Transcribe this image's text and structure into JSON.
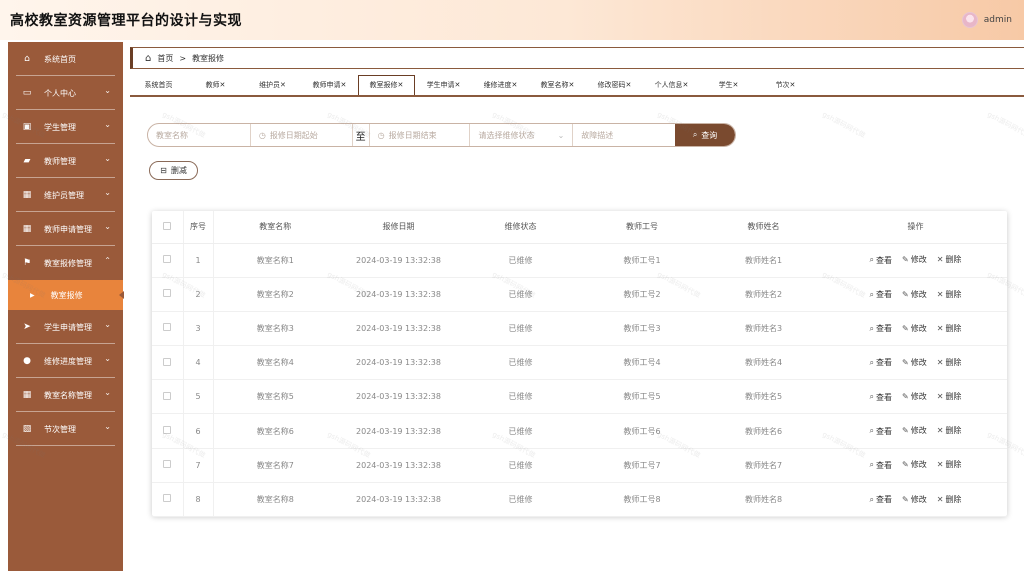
{
  "header": {
    "title": "高校教室资源管理平台的设计与实现",
    "username": "admin"
  },
  "sidebar": {
    "items": [
      {
        "label": "系统首页",
        "icon": "home-icon",
        "glyph": "⌂"
      },
      {
        "label": "个人中心",
        "icon": "id-card-icon",
        "glyph": "▭"
      },
      {
        "label": "学生管理",
        "icon": "clipboard-icon",
        "glyph": "▣"
      },
      {
        "label": "教师管理",
        "icon": "briefcase-icon",
        "glyph": "▰"
      },
      {
        "label": "维护员管理",
        "icon": "grid-icon",
        "glyph": "▦"
      },
      {
        "label": "教师申请管理",
        "icon": "grid-icon",
        "glyph": "▦"
      },
      {
        "label": "教室报修管理",
        "icon": "flag-icon",
        "glyph": "⚑"
      },
      {
        "label": "学生申请管理",
        "icon": "send-icon",
        "glyph": "➤"
      },
      {
        "label": "维修进度管理",
        "icon": "location-pin-icon",
        "glyph": "●"
      },
      {
        "label": "教室名称管理",
        "icon": "grid-icon",
        "glyph": "▦"
      },
      {
        "label": "节次管理",
        "icon": "chart-icon",
        "glyph": "▧"
      }
    ],
    "active_sub": {
      "label": "教室报修",
      "icon": "caret-right-icon",
      "glyph": "▶"
    }
  },
  "breadcrumb": {
    "home": "首页",
    "separator": ">",
    "current": "教室报修"
  },
  "tabs": [
    {
      "label": "系统首页"
    },
    {
      "label": "教师✕"
    },
    {
      "label": "维护员✕"
    },
    {
      "label": "教师申请✕"
    },
    {
      "label": "教室报修✕"
    },
    {
      "label": "学生申请✕"
    },
    {
      "label": "维修进度✕"
    },
    {
      "label": "教室名称✕"
    },
    {
      "label": "修改密码✕"
    },
    {
      "label": "个人信息✕"
    },
    {
      "label": "学生✕"
    },
    {
      "label": "节次✕"
    }
  ],
  "search": {
    "room_placeholder": "教室名称",
    "date_start_placeholder": "报修日期起始",
    "to_label": "至",
    "date_end_placeholder": "报修日期结束",
    "status_placeholder": "请选择维修状态",
    "fault_placeholder": "故障描述",
    "query_label": "查询"
  },
  "toolbar": {
    "delete_label": "删减"
  },
  "table": {
    "headers": [
      "序号",
      "教室名称",
      "报修日期",
      "维修状态",
      "教师工号",
      "教师姓名",
      "操作"
    ],
    "actions": {
      "view": "查看",
      "edit": "修改",
      "delete": "删除"
    },
    "rows": [
      {
        "no": "1",
        "room": "教室名称1",
        "date": "2024-03-19 13:32:38",
        "status": "已维修",
        "teacher_id": "教师工号1",
        "teacher_name": "教师姓名1"
      },
      {
        "no": "2",
        "room": "教室名称2",
        "date": "2024-03-19 13:32:38",
        "status": "已维修",
        "teacher_id": "教师工号2",
        "teacher_name": "教师姓名2"
      },
      {
        "no": "3",
        "room": "教室名称3",
        "date": "2024-03-19 13:32:38",
        "status": "已维修",
        "teacher_id": "教师工号3",
        "teacher_name": "教师姓名3"
      },
      {
        "no": "4",
        "room": "教室名称4",
        "date": "2024-03-19 13:32:38",
        "status": "已维修",
        "teacher_id": "教师工号4",
        "teacher_name": "教师姓名4"
      },
      {
        "no": "5",
        "room": "教室名称5",
        "date": "2024-03-19 13:32:38",
        "status": "已维修",
        "teacher_id": "教师工号5",
        "teacher_name": "教师姓名5"
      },
      {
        "no": "6",
        "room": "教室名称6",
        "date": "2024-03-19 13:32:38",
        "status": "已维修",
        "teacher_id": "教师工号6",
        "teacher_name": "教师姓名6"
      },
      {
        "no": "7",
        "room": "教室名称7",
        "date": "2024-03-19 13:32:38",
        "status": "已维修",
        "teacher_id": "教师工号7",
        "teacher_name": "教师姓名7"
      },
      {
        "no": "8",
        "room": "教室名称8",
        "date": "2024-03-19 13:32:38",
        "status": "已维修",
        "teacher_id": "教师工号8",
        "teacher_name": "教师姓名8"
      }
    ]
  },
  "watermark": "gsh源码网代做",
  "colors": {
    "sidebar": "#9a5a3a",
    "sidebar_active": "#e8843c",
    "accent_dark": "#7a4a2f"
  }
}
